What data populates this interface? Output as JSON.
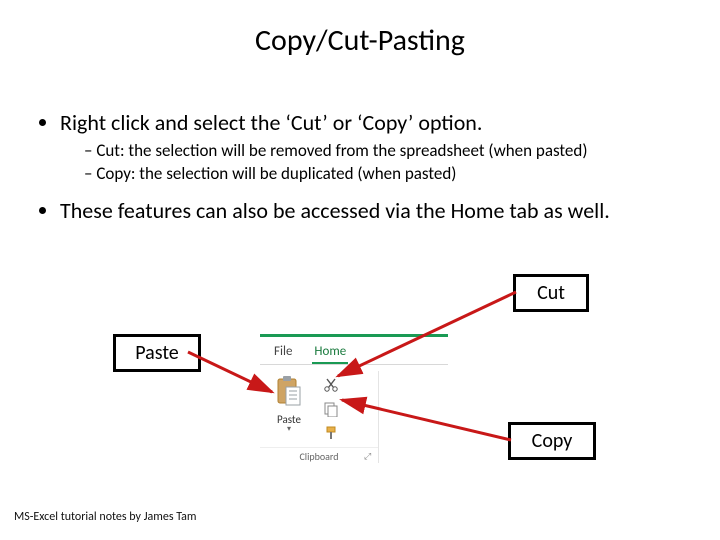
{
  "title": "Copy/Cut-Pasting",
  "bullets": {
    "b1": "Right click and select the ‘Cut’ or ‘Copy’ option.",
    "b1a": "Cut: the selection will be removed from the spreadsheet (when pasted)",
    "b1b": "Copy: the selection will be duplicated (when pasted)",
    "b2": "These features can also be accessed via the Home tab as well."
  },
  "callouts": {
    "cut": "Cut",
    "paste": "Paste",
    "copy": "Copy"
  },
  "ribbon": {
    "tabs": {
      "file": "File",
      "home": "Home"
    },
    "paste_label": "Paste",
    "group_title": "Clipboard"
  },
  "footer": "MS-Excel tutorial notes by James Tam"
}
